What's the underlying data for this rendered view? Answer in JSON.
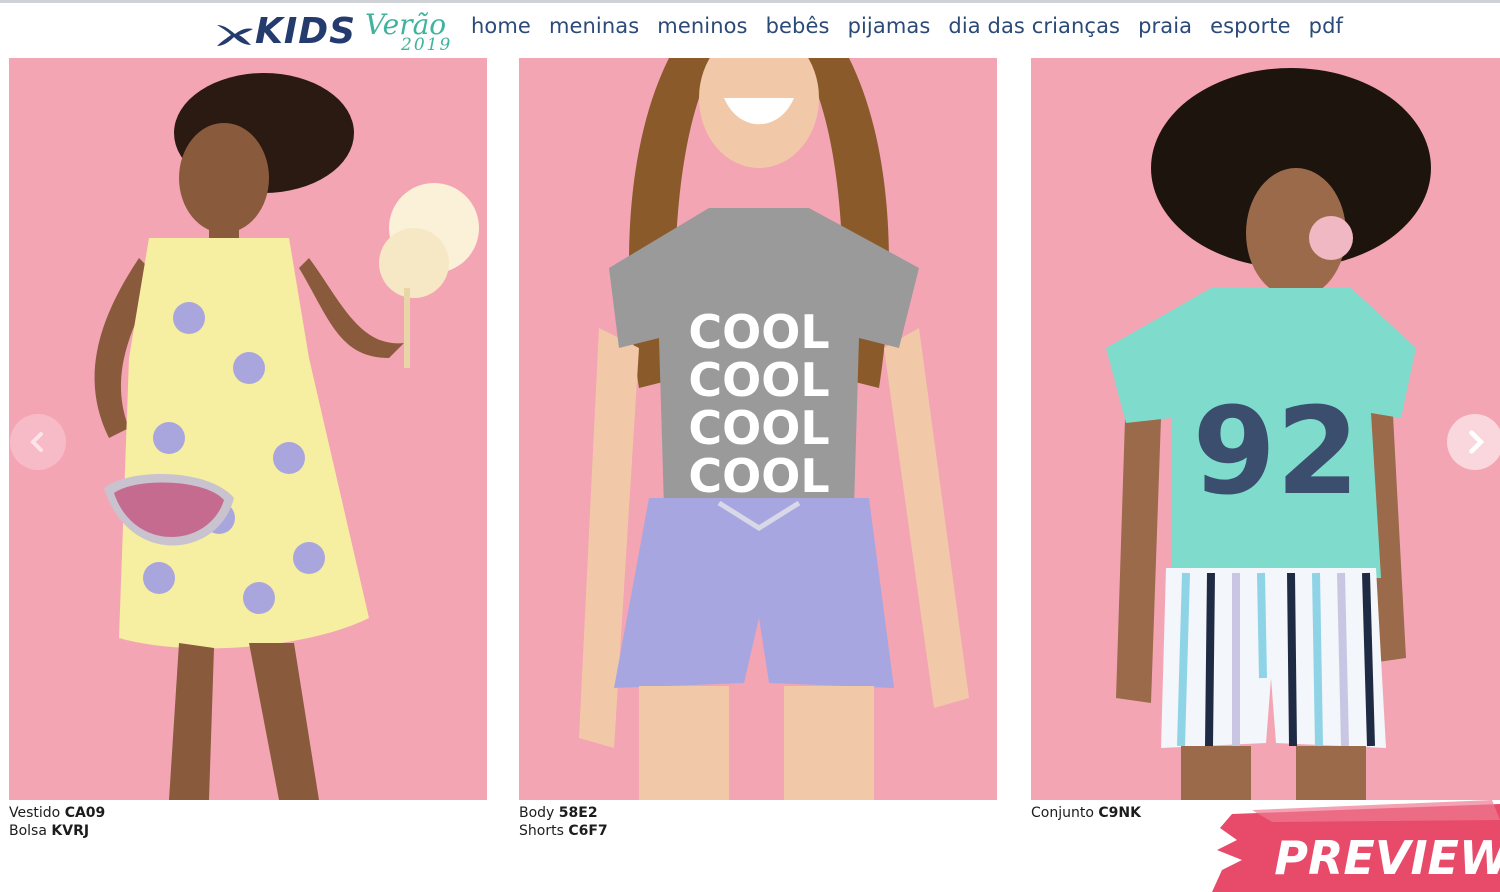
{
  "header": {
    "logo_text": "KIDS",
    "season_text": "Verão",
    "season_year": "2019",
    "nav": [
      "home",
      "meninas",
      "meninos",
      "bebês",
      "pijamas",
      "dia das crianças",
      "praia",
      "esporte",
      "pdf"
    ]
  },
  "products": [
    {
      "items": [
        {
          "label": "Vestido",
          "code": "CA09"
        },
        {
          "label": "Bolsa",
          "code": "KVRJ"
        }
      ]
    },
    {
      "tshirt_text": "COOL",
      "items": [
        {
          "label": "Body",
          "code": "58E2"
        },
        {
          "label": "Shorts",
          "code": "C6F7"
        }
      ]
    },
    {
      "tshirt_text": "92",
      "items": [
        {
          "label": "Conjunto",
          "code": "C9NK"
        }
      ]
    }
  ],
  "badge": {
    "text": "PREVIEW"
  },
  "colors": {
    "nav": "#2b4a78",
    "logo": "#243b6e",
    "season": "#3fb39c",
    "photo_bg": "#f4a5b4",
    "badge": "#e84a6a"
  },
  "icons": {
    "prev": "chevron-left-icon",
    "next": "chevron-right-icon",
    "logo": "fish-icon"
  }
}
